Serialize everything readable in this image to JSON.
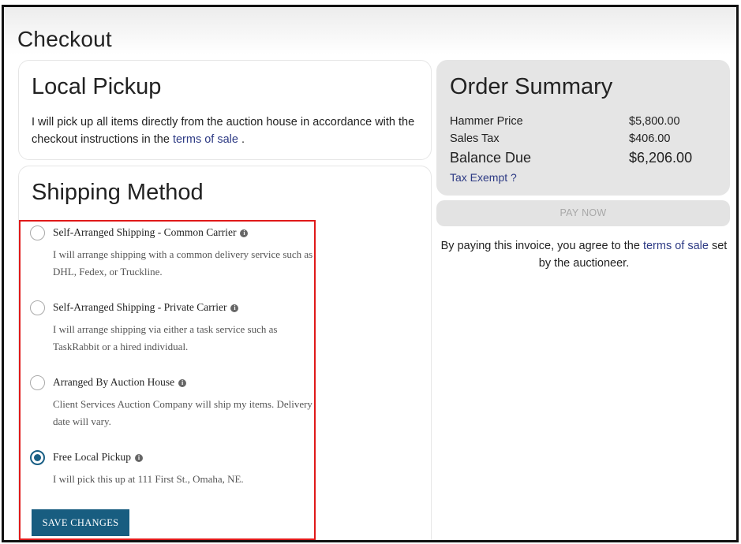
{
  "page": {
    "title": "Checkout"
  },
  "pickup": {
    "title": "Local Pickup",
    "text_before": "I will pick up all items directly from the auction house in accordance with the checkout instructions in the ",
    "link": "terms of sale",
    "text_after": " ."
  },
  "shipping": {
    "title": "Shipping Method",
    "options": [
      {
        "label": "Self-Arranged Shipping - Common Carrier",
        "description": "I will arrange shipping with a common delivery service such as DHL, Fedex, or Truckline.",
        "selected": false
      },
      {
        "label": "Self-Arranged Shipping - Private Carrier",
        "description": "I will arrange shipping via either a task service such as TaskRabbit or a hired individual.",
        "selected": false
      },
      {
        "label": "Arranged By Auction House",
        "description": "Client Services Auction Company will ship my items. Delivery date will vary.",
        "selected": false
      },
      {
        "label": "Free Local Pickup",
        "description": "I will pick this up at 111 First St., Omaha, NE.",
        "selected": true
      }
    ],
    "save_label": "SAVE CHANGES",
    "info_glyph": "i"
  },
  "summary": {
    "title": "Order Summary",
    "rows": [
      {
        "label": "Hammer Price",
        "amount": "$5,800.00"
      },
      {
        "label": "Sales Tax",
        "amount": "$406.00"
      },
      {
        "label": "Balance Due",
        "amount": "$6,206.00"
      }
    ],
    "tax_exempt": "Tax Exempt ?",
    "pay_label": "PAY NOW",
    "agree_before": "By paying this invoice, you agree to the ",
    "agree_link": "terms of sale",
    "agree_after": " set by the auctioneer."
  },
  "colors": {
    "accent": "#185d80",
    "link": "#2d3a84",
    "highlight": "#e01919"
  }
}
